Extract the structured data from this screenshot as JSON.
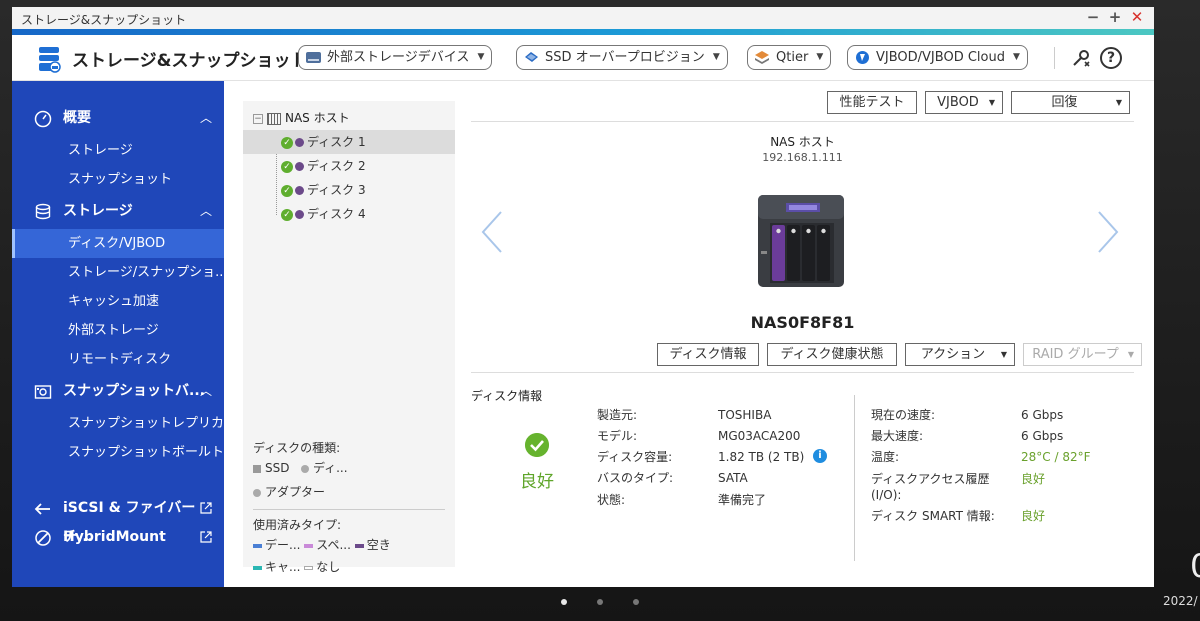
{
  "window": {
    "title": "ストレージ&スナップショット"
  },
  "toolbar": {
    "app_title": "ストレージ&スナップショット",
    "menus": [
      {
        "label": "外部ストレージデバイス"
      },
      {
        "label": "SSD オーバープロビジョン"
      },
      {
        "label": "Qtier"
      },
      {
        "label": "VJBOD/VJBOD Cloud"
      }
    ]
  },
  "sidebar": {
    "overview": {
      "label": "概要",
      "items": [
        "ストレージ",
        "スナップショット"
      ]
    },
    "storage": {
      "label": "ストレージ",
      "items": [
        "ディスク/VJBOD",
        "ストレージ/スナップショ...",
        "キャッシュ加速",
        "外部ストレージ",
        "リモートディスク"
      ],
      "active_index": 0
    },
    "snapshot": {
      "label": "スナップショットバ...",
      "items": [
        "スナップショットレプリカ",
        "スナップショットボールト"
      ]
    },
    "iscsi": {
      "label": "iSCSI & ファイバーチ..."
    },
    "hybridmount": {
      "label": "HybridMount"
    }
  },
  "tree": {
    "root": "NAS ホスト",
    "disks": [
      "ディスク 1",
      "ディスク 2",
      "ディスク 3",
      "ディスク 4"
    ],
    "selected_index": 0
  },
  "legend": {
    "disk_type_title": "ディスクの種類:",
    "ssd": "SSD",
    "disk": "ディ...",
    "adapter": "アダプター",
    "used_type_title": "使用済みタイプ:",
    "data": "デー...",
    "spare": "スペ...",
    "free": "空き",
    "cache": "キャ...",
    "none": "なし",
    "colors": {
      "ssd": "#999999",
      "disk": "#aaaaaa",
      "data": "#4a7fd4",
      "spare": "#c98ad8",
      "free": "#6b4a8a",
      "cache": "#2bb7b3",
      "none": "#ffffff"
    }
  },
  "main": {
    "top_buttons": {
      "perf_test": "性能テスト",
      "vjbod": "VJBOD",
      "recover": "回復"
    },
    "nas_name": "NAS ホスト",
    "nas_ip": "192.168.1.111",
    "nas_model": "NAS0F8F81",
    "actions": {
      "disk_info": "ディスク情報",
      "disk_health": "ディスク健康状態",
      "action": "アクション",
      "raid_group": "RAID グループ"
    },
    "disk_info_title": "ディスク情報",
    "status": "良好",
    "left_info": [
      {
        "key": "製造元:",
        "value": "TOSHIBA"
      },
      {
        "key": "モデル:",
        "value": "MG03ACA200"
      },
      {
        "key": "ディスク容量:",
        "value": "1.82 TB (2 TB)"
      },
      {
        "key": "バスのタイプ:",
        "value": "SATA"
      },
      {
        "key": "状態:",
        "value": "準備完了"
      }
    ],
    "right_info": [
      {
        "key": "現在の速度:",
        "value": "6 Gbps"
      },
      {
        "key": "最大速度:",
        "value": "6 Gbps"
      },
      {
        "key": "温度:",
        "value": "28°C / 82°F"
      },
      {
        "key": "ディスクアクセス履歴 (I/O):",
        "value": "良好"
      },
      {
        "key": "ディスク SMART 情報:",
        "value": "良好"
      }
    ]
  },
  "desktop": {
    "clock_partial": "0",
    "date_partial": "2022/"
  },
  "colors": {
    "sidebar": "#1f47b9",
    "sidebar_active": "#3566d7",
    "status_green": "#66b32e",
    "close_red": "#d8312c"
  }
}
